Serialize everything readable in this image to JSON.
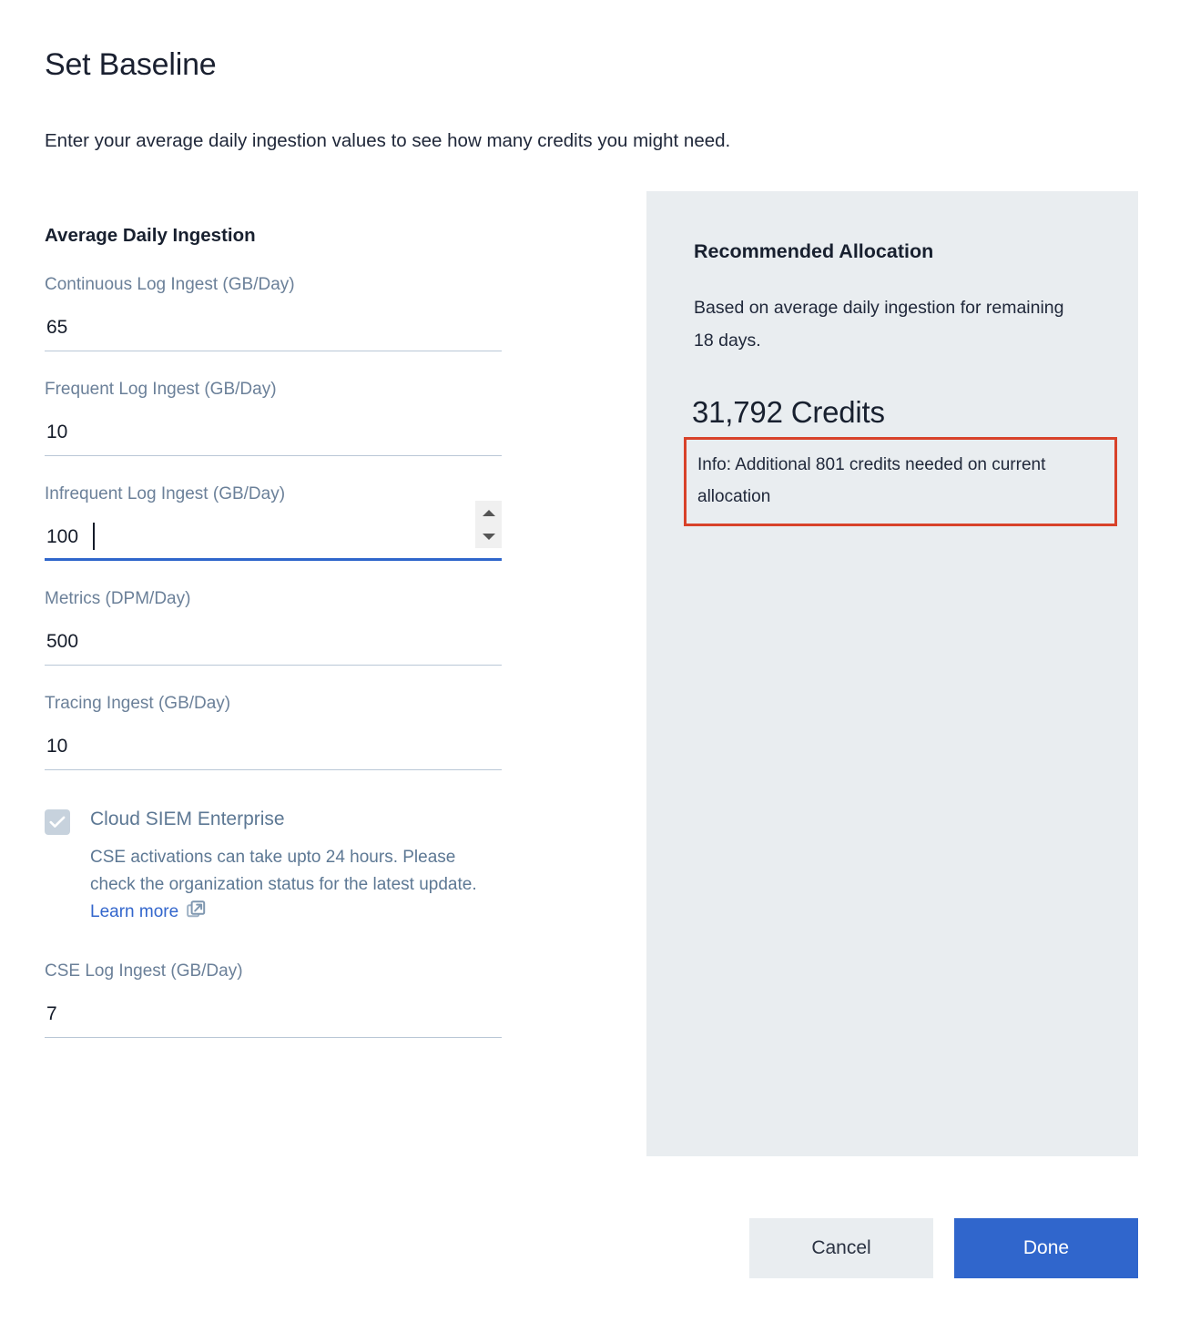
{
  "dialog": {
    "title": "Set Baseline",
    "subtitle": "Enter your average daily ingestion values to see how many credits you might need."
  },
  "form": {
    "section_title": "Average Daily Ingestion",
    "fields": [
      {
        "label": "Continuous Log Ingest (GB/Day)",
        "value": "65",
        "focused": false
      },
      {
        "label": "Frequent Log Ingest (GB/Day)",
        "value": "10",
        "focused": false
      },
      {
        "label": "Infrequent Log Ingest (GB/Day)",
        "value": "100",
        "focused": true
      },
      {
        "label": "Metrics (DPM/Day)",
        "value": "500",
        "focused": false
      },
      {
        "label": "Tracing Ingest (GB/Day)",
        "value": "10",
        "focused": false
      }
    ],
    "cse": {
      "checkbox_label": "Cloud SIEM Enterprise",
      "checked": true,
      "description": "CSE activations can take upto 24 hours. Please check the organization status for the latest update.",
      "learn_more_label": "Learn more",
      "external_link_icon": "external-link-icon"
    },
    "cse_field": {
      "label": "CSE Log Ingest (GB/Day)",
      "value": "7"
    },
    "spinner": {
      "up_icon": "caret-up-icon",
      "down_icon": "caret-down-icon"
    }
  },
  "panel": {
    "title": "Recommended Allocation",
    "subtitle": "Based on average daily ingestion for remaining 18 days.",
    "credits": "31,792 Credits",
    "info_message": "Info: Additional 801 credits needed on current allocation"
  },
  "footer": {
    "cancel_label": "Cancel",
    "done_label": "Done"
  },
  "colors": {
    "primary_blue": "#3066cc",
    "panel_bg": "#e9edf0",
    "alert_red": "#d8422a",
    "label_gray": "#6b8099",
    "underline": "#b9c7d6",
    "link_blue": "#3366cc"
  }
}
